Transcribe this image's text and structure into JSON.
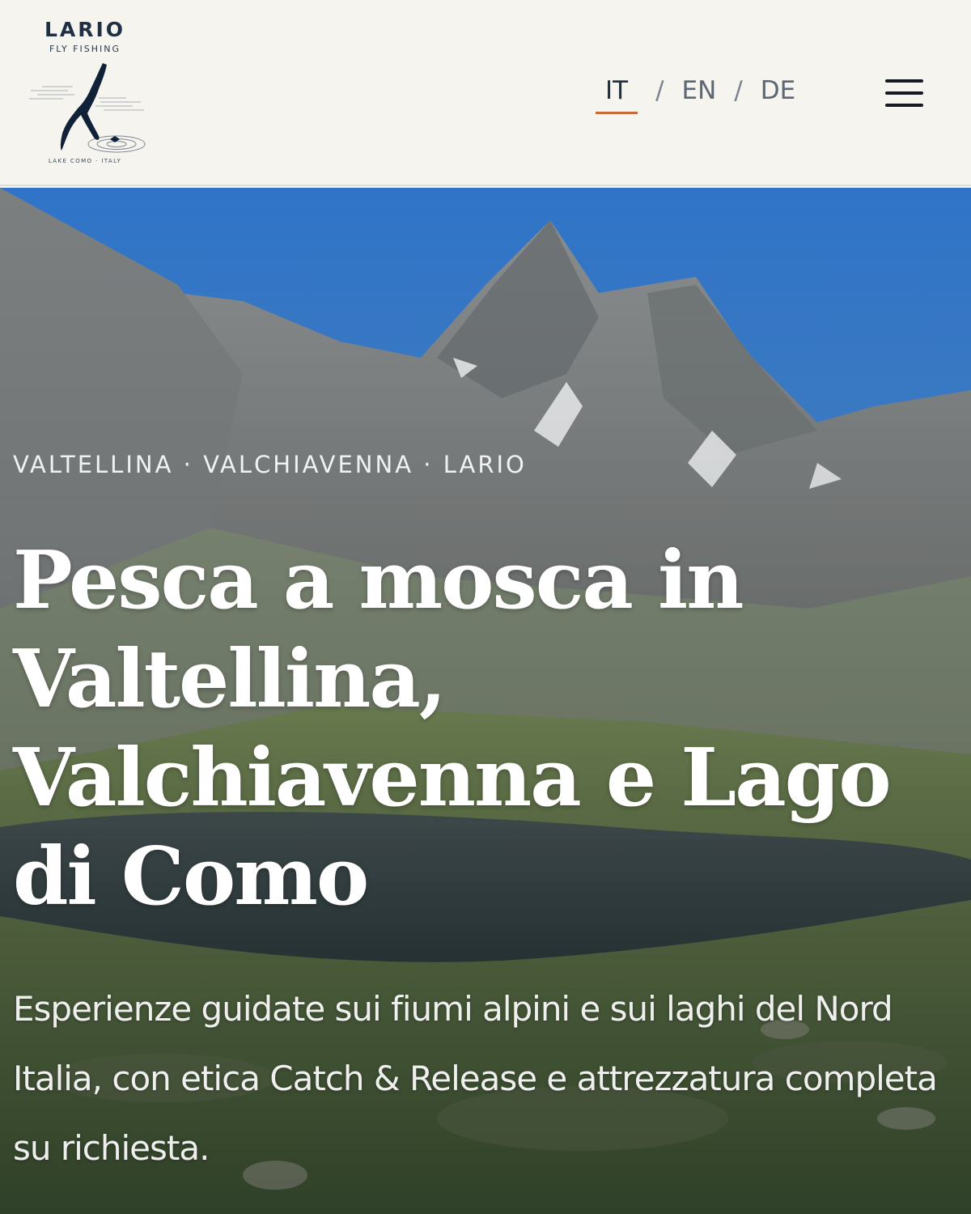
{
  "header": {
    "logo": {
      "title": "LARIO",
      "subtitle": "FLY FISHING",
      "footer": "LAKE COMO · ITALY",
      "mark_icon": "lake-como-map-icon"
    },
    "languages": [
      {
        "label": "IT",
        "active": true
      },
      {
        "label": "EN",
        "active": false
      },
      {
        "label": "DE",
        "active": false
      }
    ],
    "separator": "/",
    "menu_icon": "hamburger-menu-icon"
  },
  "hero": {
    "eyebrow": "VALTELLINA · VALCHIAVENNA · LARIO",
    "headline": "Pesca a mosca in Valtellina, Valchiavenna e Lago di Como",
    "lead": "Esperienze guidate sui fiumi alpini e sui laghi del Nord Italia, con etica Catch & Release e attrezzatura completa su richiesta.",
    "image": "alpine-lake-mountain-photo"
  },
  "colors": {
    "header_bg": "#f6f4ef",
    "brand_navy": "#1f2f44",
    "accent_underline": "#c66a3a",
    "headline_text": "#ffffff"
  }
}
